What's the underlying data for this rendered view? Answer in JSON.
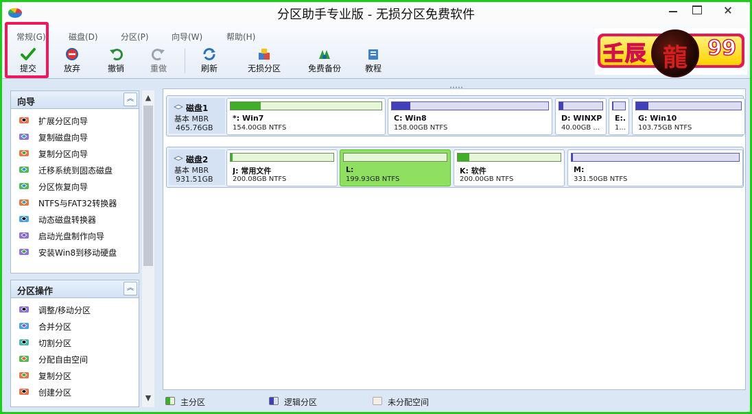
{
  "window": {
    "title": "分区助手专业版 - 无损分区免费软件"
  },
  "menu": [
    "常规(G)",
    "磁盘(D)",
    "分区(P)",
    "向导(W)",
    "帮助(H)"
  ],
  "toolbar": {
    "commit": "提交",
    "discard": "放弃",
    "undo": "撤销",
    "redo": "重做",
    "refresh": "刷新",
    "lossless": "无损分区",
    "backup": "免费备份",
    "tutorial": "教程"
  },
  "logo": {
    "text": "壬辰",
    "emblem": "龍",
    "number": "99"
  },
  "wizard_panel": {
    "title": "向导",
    "items": [
      {
        "label": "扩展分区向导",
        "icon": "extend-partition-icon"
      },
      {
        "label": "复制磁盘向导",
        "icon": "copy-disk-icon"
      },
      {
        "label": "复制分区向导",
        "icon": "copy-partition-icon"
      },
      {
        "label": "迁移系统到固态磁盘",
        "icon": "migrate-os-icon"
      },
      {
        "label": "分区恢复向导",
        "icon": "partition-recovery-icon"
      },
      {
        "label": "NTFS与FAT32转换器",
        "icon": "ntfs-fat32-converter-icon"
      },
      {
        "label": "动态磁盘转换器",
        "icon": "dynamic-disk-icon"
      },
      {
        "label": "启动光盘制作向导",
        "icon": "bootable-cd-icon"
      },
      {
        "label": "安装Win8到移动硬盘",
        "icon": "win8-to-go-icon"
      }
    ]
  },
  "partition_ops_panel": {
    "title": "分区操作",
    "items": [
      {
        "label": "调整/移动分区",
        "icon": "resize-move-icon"
      },
      {
        "label": "合并分区",
        "icon": "merge-partition-icon"
      },
      {
        "label": "切割分区",
        "icon": "split-partition-icon"
      },
      {
        "label": "分配自由空间",
        "icon": "allocate-space-icon"
      },
      {
        "label": "复制分区",
        "icon": "copy-partition-icon"
      },
      {
        "label": "创建分区",
        "icon": "create-partition-icon"
      }
    ]
  },
  "disks": [
    {
      "name": "磁盘1",
      "type": "基本 MBR",
      "size": "465.76GB",
      "partitions": [
        {
          "name": "*: Win7",
          "info": "154.00GB NTFS",
          "kind": "primary",
          "used": 0.2
        },
        {
          "name": "C: Win8",
          "info": "158.00GB NTFS",
          "kind": "logical",
          "used": 0.12
        },
        {
          "name": "D: WINXP",
          "info": "40.00GB ...",
          "kind": "logical",
          "used": 0.1
        },
        {
          "name": "E:...",
          "info": "1...",
          "kind": "logical",
          "used": 0.05
        },
        {
          "name": "G: Win10",
          "info": "103.75GB NTFS",
          "kind": "logical",
          "used": 0.12
        }
      ]
    },
    {
      "name": "磁盘2",
      "type": "基本 MBR",
      "size": "931.51GB",
      "partitions": [
        {
          "name": "J: 常用文件",
          "info": "200.08GB NTFS",
          "kind": "primary",
          "used": 0.02
        },
        {
          "name": "L:",
          "info": "199.93GB NTFS",
          "kind": "primary",
          "used": 0.0,
          "selected": true
        },
        {
          "name": "K: 软件",
          "info": "200.00GB NTFS",
          "kind": "primary",
          "used": 0.11
        },
        {
          "name": "M:",
          "info": "331.50GB NTFS",
          "kind": "logical",
          "used": 0.01
        }
      ]
    }
  ],
  "legend": {
    "primary": "主分区",
    "logical": "逻辑分区",
    "unallocated": "未分配空间"
  },
  "colors": {
    "primary_fill": "#3fae2a",
    "logical_fill": "#4040b8",
    "selected_partition": "#8fe061",
    "highlight": "#f0185a"
  }
}
